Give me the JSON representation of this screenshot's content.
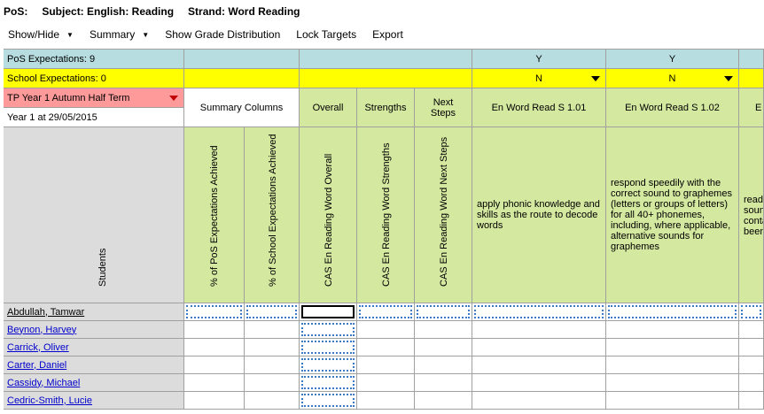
{
  "title": {
    "pos": "PoS:",
    "subject": "Subject: English: Reading",
    "strand": "Strand: Word Reading"
  },
  "toolbar": {
    "show_hide": "Show/Hide",
    "summary": "Summary",
    "show_grade_distribution": "Show Grade Distribution",
    "lock_targets": "Lock Targets",
    "export": "Export"
  },
  "header": {
    "pos_expectations": "PoS Expectations: 9",
    "school_expectations": "School Expectations: 0",
    "term": "TP Year 1 Autumn Half Term",
    "year_date": "Year  1 at 29/05/2015",
    "students_label": "Students",
    "summary_columns": "Summary Columns",
    "overall": "Overall",
    "strengths": "Strengths",
    "next_steps": "Next Steps"
  },
  "columns": {
    "pct_pos": "% of PoS Expectations Achieved",
    "pct_school": "% of School Expectations Achieved",
    "cas_overall": "CAS En Reading Word Overall",
    "cas_strengths": "CAS En Reading Word Strengths",
    "cas_next_steps": "CAS En Reading Word Next Steps"
  },
  "objectives": [
    {
      "flag_y": "Y",
      "flag_n": "N",
      "name": "En Word Read S  1.01",
      "description": "apply phonic knowledge and skills as the route to decode words"
    },
    {
      "flag_y": "Y",
      "flag_n": "N",
      "name": "En Word Read S  1.02",
      "description": "respond speedily with the correct sound to graphemes (letters or groups of letters) for all 40+ phonemes, including, where applicable, alternative sounds for graphemes"
    },
    {
      "name": "E",
      "description": "read soun conta been"
    }
  ],
  "students": [
    "Abdullah, Tamwar",
    "Beynon, Harvey",
    "Carrick, Oliver",
    "Carter, Daniel",
    "Cassidy, Michael",
    "Cedric-Smith, Lucie"
  ],
  "colors": {
    "teal": "#b7dde0",
    "yellow": "#ffff00",
    "green": "#d4e8a0",
    "pink": "#ff9a9a",
    "grey": "#dcdcdc"
  }
}
